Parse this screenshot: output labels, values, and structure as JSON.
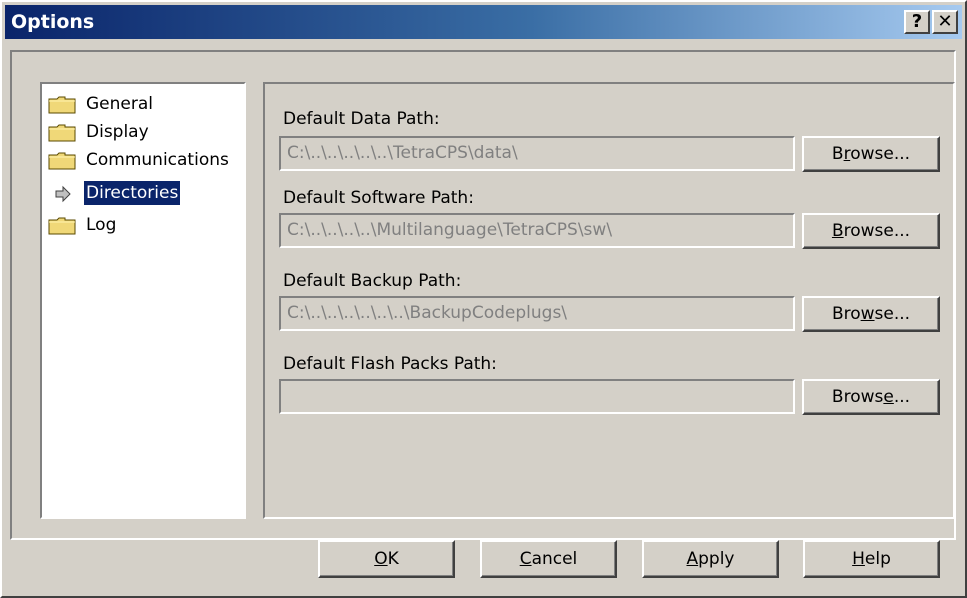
{
  "window": {
    "title": "Options",
    "help_button": "?",
    "close_button": "✕"
  },
  "tree": {
    "items": [
      {
        "label": "General",
        "icon": "folder-icon",
        "selected": false
      },
      {
        "label": "Display",
        "icon": "folder-icon",
        "selected": false
      },
      {
        "label": "Communications",
        "icon": "folder-icon",
        "selected": false
      },
      {
        "label": "Directories",
        "icon": "arrow-right-icon",
        "selected": true
      },
      {
        "label": "Log",
        "icon": "folder-icon",
        "selected": false
      }
    ]
  },
  "directories": {
    "data_path": {
      "label": "Default Data Path:",
      "value": "C:\\..\\..\\..\\..\\..\\TetraCPS\\data\\",
      "browse": "Browse..."
    },
    "software_path": {
      "label": "Default Software Path:",
      "value": "C:\\..\\..\\..\\..\\Multilanguage\\TetraCPS\\sw\\",
      "browse": "Browse..."
    },
    "backup_path": {
      "label": "Default Backup Path:",
      "value": "C:\\..\\..\\..\\..\\..\\..\\BackupCodeplugs\\",
      "browse": "Browse..."
    },
    "flash_path": {
      "label": "Default Flash Packs Path:",
      "value": "",
      "browse": "Browse..."
    }
  },
  "buttons": {
    "ok": "OK",
    "cancel": "Cancel",
    "apply": "Apply",
    "help": "Help"
  },
  "colors": {
    "title_start": "#0a246a",
    "title_end": "#a6caf0",
    "face": "#d4d0c8",
    "selection": "#0a246a",
    "disabled_text": "#808080"
  }
}
